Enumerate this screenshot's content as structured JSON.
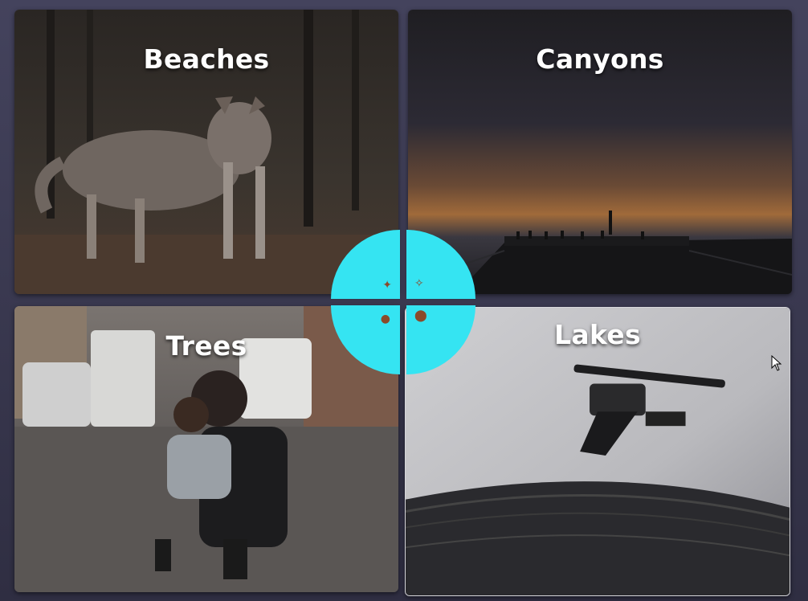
{
  "tiles": {
    "beaches": {
      "label": "Beaches",
      "icon": "coyote-photo"
    },
    "canyons": {
      "label": "Canyons",
      "icon": "pier-sunset-photo"
    },
    "trees": {
      "label": "Trees",
      "icon": "mother-child-street-photo"
    },
    "lakes": {
      "label": "Lakes",
      "icon": "turntable-photo"
    }
  },
  "center_dial": {
    "accent_color": "#35e4f2",
    "quadrants": [
      {
        "name": "top-left",
        "icon": "coyote-thumb-icon"
      },
      {
        "name": "top-right",
        "icon": "pier-thumb-icon"
      },
      {
        "name": "bottom-left",
        "icon": "people-thumb-icon"
      },
      {
        "name": "bottom-right",
        "icon": "turntable-thumb-icon"
      }
    ]
  },
  "colors": {
    "background": "#3b3a52",
    "title_text": "#ffffff"
  }
}
